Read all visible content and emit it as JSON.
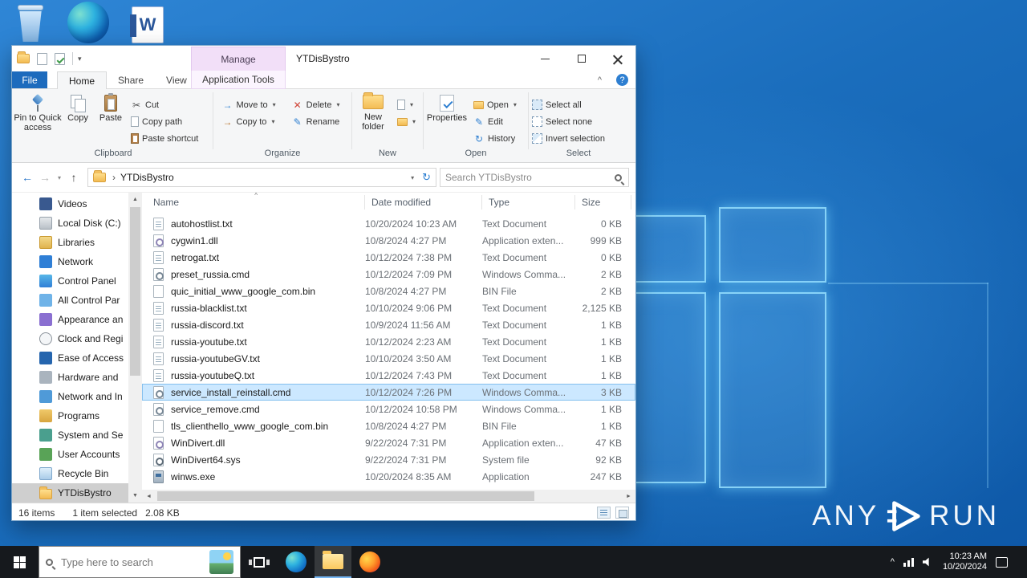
{
  "icons": {
    "back": "←",
    "forward": "→",
    "up": "↑",
    "dropdown": "▾",
    "refresh": "↻",
    "collapse_ribbon": "^",
    "help": "?",
    "sort": "^",
    "breadcrumb": "›",
    "cut": "✂",
    "delete_x": "✕",
    "pencil": "✎",
    "history": "↻",
    "arrow_right": "→",
    "scroll_up": "▲",
    "scroll_down": "▼",
    "scroll_left": "◄",
    "scroll_right": "►",
    "tray_chevron": "^",
    "word": "W"
  },
  "window": {
    "title": "YTDisBystro",
    "contextual": {
      "tab": "Manage",
      "group": "Application Tools"
    },
    "file_tab": "File",
    "tabs": [
      "Home",
      "Share",
      "View"
    ],
    "ribbon": {
      "clipboard": {
        "label": "Clipboard",
        "pin": "Pin to Quick access",
        "copy": "Copy",
        "paste": "Paste",
        "cut": "Cut",
        "copy_path": "Copy path",
        "paste_shortcut": "Paste shortcut"
      },
      "organize": {
        "label": "Organize",
        "move_to": "Move to",
        "copy_to": "Copy to",
        "del": "Delete",
        "rename": "Rename"
      },
      "new_group": {
        "label": "New",
        "new_folder": "New folder"
      },
      "open_group": {
        "label": "Open",
        "properties": "Properties",
        "open": "Open",
        "edit": "Edit",
        "history": "History"
      },
      "select_group": {
        "label": "Select",
        "select_all": "Select all",
        "select_none": "Select none",
        "invert": "Invert selection"
      }
    },
    "address": {
      "path": "YTDisBystro",
      "search_placeholder": "Search YTDisBystro"
    },
    "columns": [
      "Name",
      "Date modified",
      "Type",
      "Size"
    ],
    "sidebar": {
      "items": [
        {
          "label": "Videos",
          "icon": "videos",
          "selected": false
        },
        {
          "label": "Local Disk (C:)",
          "icon": "disk",
          "selected": false
        },
        {
          "label": "Libraries",
          "icon": "libraries",
          "selected": false
        },
        {
          "label": "Network",
          "icon": "network",
          "selected": false
        },
        {
          "label": "Control Panel",
          "icon": "control",
          "selected": false
        },
        {
          "label": "All Control Par",
          "icon": "allcontrol",
          "selected": false
        },
        {
          "label": "Appearance an",
          "icon": "appearance",
          "selected": false
        },
        {
          "label": "Clock and Regi",
          "icon": "clock",
          "selected": false
        },
        {
          "label": "Ease of Access",
          "icon": "access",
          "selected": false
        },
        {
          "label": "Hardware and",
          "icon": "hardware",
          "selected": false
        },
        {
          "label": "Network and In",
          "icon": "network2",
          "selected": false
        },
        {
          "label": "Programs",
          "icon": "programs",
          "selected": false
        },
        {
          "label": "System and Se",
          "icon": "system",
          "selected": false
        },
        {
          "label": "User Accounts",
          "icon": "users",
          "selected": false
        },
        {
          "label": "Recycle Bin",
          "icon": "recycle",
          "selected": false
        },
        {
          "label": "YTDisBystro",
          "icon": "folder",
          "selected": true
        }
      ]
    },
    "files": [
      {
        "name": "autohostlist.txt",
        "date": "10/20/2024 10:23 AM",
        "type": "Text Document",
        "size": "0 KB",
        "icon": "txt",
        "selected": false
      },
      {
        "name": "cygwin1.dll",
        "date": "10/8/2024 4:27 PM",
        "type": "Application exten...",
        "size": "999 KB",
        "icon": "dll",
        "selected": false
      },
      {
        "name": "netrogat.txt",
        "date": "10/12/2024 7:38 PM",
        "type": "Text Document",
        "size": "0 KB",
        "icon": "txt",
        "selected": false
      },
      {
        "name": "preset_russia.cmd",
        "date": "10/12/2024 7:09 PM",
        "type": "Windows Comma...",
        "size": "2 KB",
        "icon": "cmd",
        "selected": false
      },
      {
        "name": "quic_initial_www_google_com.bin",
        "date": "10/8/2024 4:27 PM",
        "type": "BIN File",
        "size": "2 KB",
        "icon": "bin",
        "selected": false
      },
      {
        "name": "russia-blacklist.txt",
        "date": "10/10/2024 9:06 PM",
        "type": "Text Document",
        "size": "2,125 KB",
        "icon": "txt",
        "selected": false
      },
      {
        "name": "russia-discord.txt",
        "date": "10/9/2024 11:56 AM",
        "type": "Text Document",
        "size": "1 KB",
        "icon": "txt",
        "selected": false
      },
      {
        "name": "russia-youtube.txt",
        "date": "10/12/2024 2:23 AM",
        "type": "Text Document",
        "size": "1 KB",
        "icon": "txt",
        "selected": false
      },
      {
        "name": "russia-youtubeGV.txt",
        "date": "10/10/2024 3:50 AM",
        "type": "Text Document",
        "size": "1 KB",
        "icon": "txt",
        "selected": false
      },
      {
        "name": "russia-youtubeQ.txt",
        "date": "10/12/2024 7:43 PM",
        "type": "Text Document",
        "size": "1 KB",
        "icon": "txt",
        "selected": false
      },
      {
        "name": "service_install_reinstall.cmd",
        "date": "10/12/2024 7:26 PM",
        "type": "Windows Comma...",
        "size": "3 KB",
        "icon": "cmd",
        "selected": true
      },
      {
        "name": "service_remove.cmd",
        "date": "10/12/2024 10:58 PM",
        "type": "Windows Comma...",
        "size": "1 KB",
        "icon": "cmd",
        "selected": false
      },
      {
        "name": "tls_clienthello_www_google_com.bin",
        "date": "10/8/2024 4:27 PM",
        "type": "BIN File",
        "size": "1 KB",
        "icon": "bin",
        "selected": false
      },
      {
        "name": "WinDivert.dll",
        "date": "9/22/2024 7:31 PM",
        "type": "Application exten...",
        "size": "47 KB",
        "icon": "dll",
        "selected": false
      },
      {
        "name": "WinDivert64.sys",
        "date": "9/22/2024 7:31 PM",
        "type": "System file",
        "size": "92 KB",
        "icon": "sys",
        "selected": false
      },
      {
        "name": "winws.exe",
        "date": "10/20/2024 8:35 AM",
        "type": "Application",
        "size": "247 KB",
        "icon": "exe",
        "selected": false
      }
    ],
    "status": {
      "items": "16 items",
      "selection": "1 item selected",
      "size": "2.08 KB"
    }
  },
  "taskbar": {
    "search_placeholder": "Type here to search",
    "time": "10:23 AM",
    "date": "10/20/2024"
  },
  "watermark": {
    "left": "ANY",
    "right": "RUN"
  }
}
